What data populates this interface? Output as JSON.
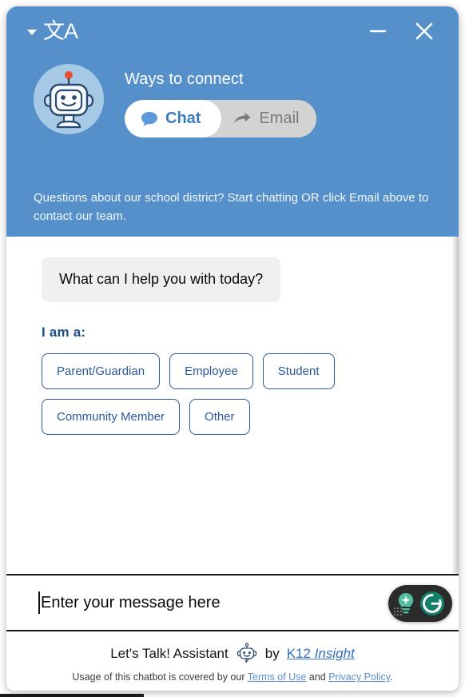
{
  "header": {
    "language_icon": "translate-icon",
    "language_glyph": "文A",
    "minimize_label": "—",
    "close_label": "✕",
    "avatar_icon": "robot-avatar-icon",
    "title": "Ways to connect",
    "toggle": {
      "chat": {
        "label": "Chat",
        "icon": "speech-bubble-icon",
        "active": true
      },
      "email": {
        "label": "Email",
        "icon": "arrow-forward-icon",
        "active": false
      }
    },
    "description": "Questions about our school district? Start chatting OR click Email above to contact our team.",
    "bg_color": "#5590CB"
  },
  "conversation": {
    "bot_message": "What can I help you with today?",
    "prompt_label": "I am a:",
    "choices": [
      {
        "label": "Parent/Guardian"
      },
      {
        "label": "Employee"
      },
      {
        "label": "Student"
      },
      {
        "label": "Community Member"
      },
      {
        "label": "Other"
      }
    ],
    "accent_color": "#29589C",
    "bubble_bg": "#EFF0F2"
  },
  "composer": {
    "placeholder": "Enter your message here",
    "value": "",
    "assistant_badge": {
      "ai_icon": "lightbulb-icon",
      "grammarly_icon": "grammarly-g-icon",
      "drag_handle_icon": "drag-dots-icon"
    }
  },
  "footer": {
    "assistant_name": "Let's Talk! Assistant",
    "assistant_icon": "robot-icon",
    "by_text": "by",
    "brand_name": "K12",
    "brand_name_italic": "Insight",
    "legal_prefix": "Usage of this chatbot is covered by our",
    "terms_label": "Terms of Use",
    "legal_conjunction": "and",
    "privacy_label": "Privacy Policy",
    "legal_suffix": "."
  }
}
